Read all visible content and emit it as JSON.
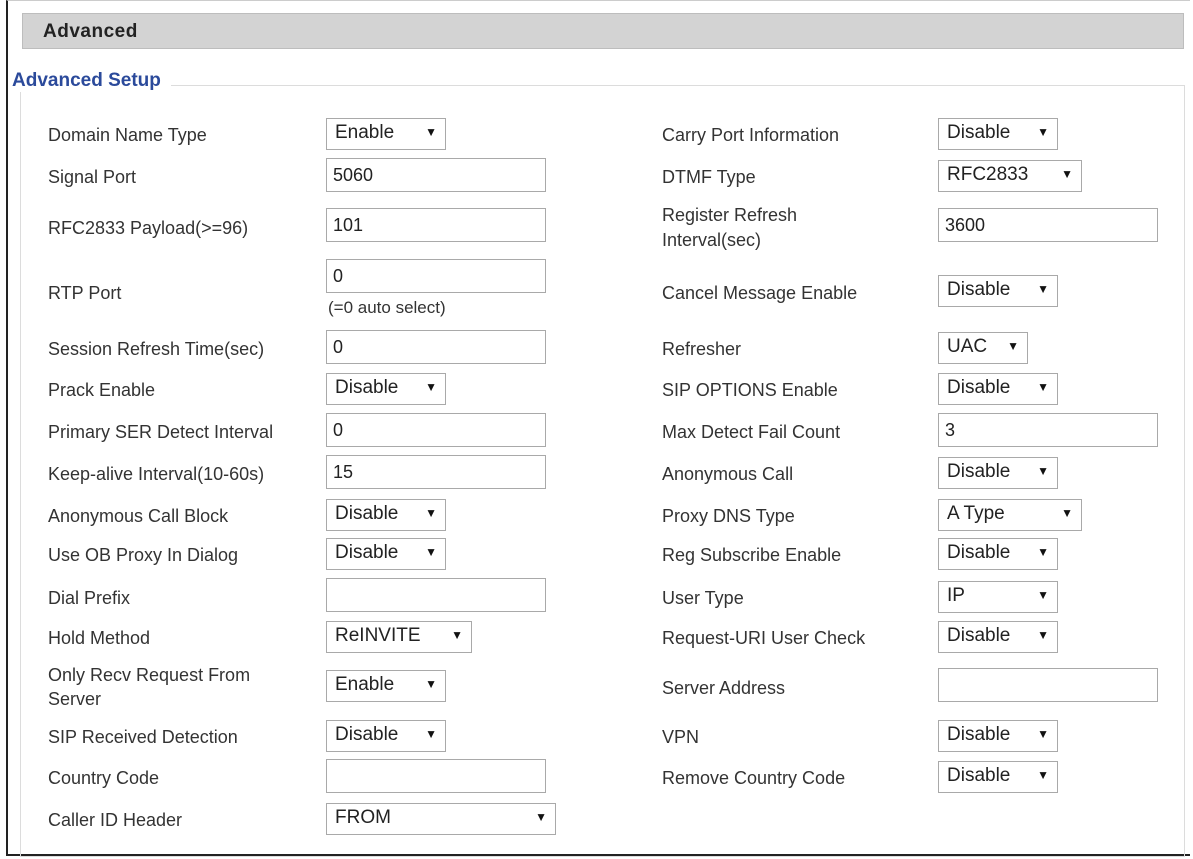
{
  "header": {
    "title": "Advanced"
  },
  "section": {
    "legend": "Advanced Setup"
  },
  "left": {
    "domain_name_type": {
      "label": "Domain Name Type",
      "value": "Enable"
    },
    "signal_port": {
      "label": "Signal Port",
      "value": "5060"
    },
    "rfc2833_payload": {
      "label": "RFC2833 Payload(>=96)",
      "value": "101"
    },
    "rtp_port": {
      "label": "RTP Port",
      "value": "0",
      "hint": "(=0 auto select)"
    },
    "session_refresh_time": {
      "label": "Session Refresh Time(sec)",
      "value": "0"
    },
    "prack_enable": {
      "label": "Prack Enable",
      "value": "Disable"
    },
    "primary_ser_detect_interval": {
      "label": "Primary SER Detect Interval",
      "value": "0"
    },
    "keep_alive_interval": {
      "label": "Keep-alive Interval(10-60s)",
      "value": "15"
    },
    "anonymous_call_block": {
      "label": "Anonymous Call Block",
      "value": "Disable"
    },
    "use_ob_proxy_in_dialog": {
      "label": "Use OB Proxy In Dialog",
      "value": "Disable"
    },
    "dial_prefix": {
      "label": "Dial Prefix",
      "value": ""
    },
    "hold_method": {
      "label": "Hold Method",
      "value": "ReINVITE"
    },
    "only_recv_request_from_server": {
      "label_line1": "Only Recv Request From",
      "label_line2": "Server",
      "value": "Enable"
    },
    "sip_received_detection": {
      "label": "SIP Received Detection",
      "value": "Disable"
    },
    "country_code": {
      "label": "Country Code",
      "value": ""
    },
    "caller_id_header": {
      "label": "Caller ID Header",
      "value": "FROM"
    }
  },
  "right": {
    "carry_port_information": {
      "label": "Carry Port Information",
      "value": "Disable"
    },
    "dtmf_type": {
      "label": "DTMF Type",
      "value": "RFC2833"
    },
    "register_refresh_interval": {
      "label_line1": "Register Refresh",
      "label_line2": "Interval(sec)",
      "value": "3600"
    },
    "cancel_message_enable": {
      "label": "Cancel Message Enable",
      "value": "Disable"
    },
    "refresher": {
      "label": "Refresher",
      "value": "UAC"
    },
    "sip_options_enable": {
      "label": "SIP OPTIONS Enable",
      "value": "Disable"
    },
    "max_detect_fail_count": {
      "label": "Max Detect Fail Count",
      "value": "3"
    },
    "anonymous_call": {
      "label": "Anonymous Call",
      "value": "Disable"
    },
    "proxy_dns_type": {
      "label": "Proxy DNS Type",
      "value": "A Type"
    },
    "reg_subscribe_enable": {
      "label": "Reg Subscribe Enable",
      "value": "Disable"
    },
    "user_type": {
      "label": "User Type",
      "value": "IP"
    },
    "request_uri_user_check": {
      "label": "Request-URI User Check",
      "value": "Disable"
    },
    "server_address": {
      "label": "Server Address",
      "value": ""
    },
    "vpn": {
      "label": "VPN",
      "value": "Disable"
    },
    "remove_country_code": {
      "label": "Remove Country Code",
      "value": "Disable"
    }
  },
  "icons": {
    "dropdown": "dropdown-arrow-icon",
    "glyph": "▼"
  }
}
